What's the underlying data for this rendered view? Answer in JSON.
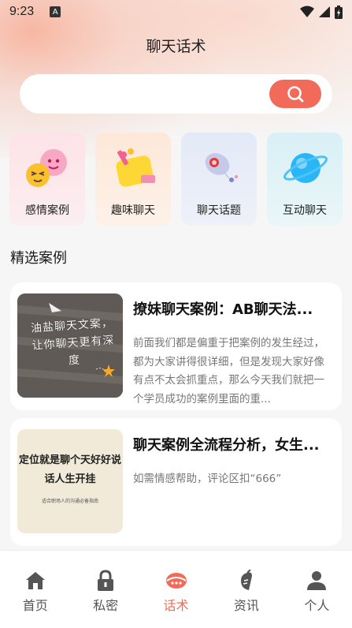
{
  "status": {
    "time": "9:23",
    "a_badge": "A"
  },
  "header": {
    "title": "聊天话术"
  },
  "search": {
    "placeholder": ""
  },
  "categories": [
    {
      "label": "感情案例",
      "icon": "love-bubble-icon"
    },
    {
      "label": "趣味聊天",
      "icon": "chat-pencil-icon"
    },
    {
      "label": "聊天话题",
      "icon": "rocket-icon"
    },
    {
      "label": "互动聊天",
      "icon": "planet-icon"
    }
  ],
  "section": {
    "title": "精选案例"
  },
  "articles": [
    {
      "title": "撩妹聊天案例：AB聊天法...",
      "desc": "前面我们都是偏重于把案例的发生经过，都为大家讲得很详细，但是发现大家好像有点不太会抓重点，那么今天我们就把一个学员成功的案例里面的重...",
      "thumb_text": "油盐聊天文案，让你聊天更有深度"
    },
    {
      "title": "聊天案例全流程分析，女生...",
      "desc": "如需情感帮助，评论区扣“666”",
      "thumb_text": "定位就是聊个天好好说话人生开挂",
      "thumb_sub": "适合职场人的沟通必备指南"
    }
  ],
  "nav": [
    {
      "label": "首页",
      "icon": "home-icon",
      "active": false
    },
    {
      "label": "私密",
      "icon": "lock-icon",
      "active": false
    },
    {
      "label": "话术",
      "icon": "chat-talk-icon",
      "active": true
    },
    {
      "label": "资讯",
      "icon": "news-icon",
      "active": false
    },
    {
      "label": "个人",
      "icon": "person-icon",
      "active": false
    }
  ],
  "colors": {
    "accent": "#f26b5a",
    "background": "#f6f6f6"
  }
}
